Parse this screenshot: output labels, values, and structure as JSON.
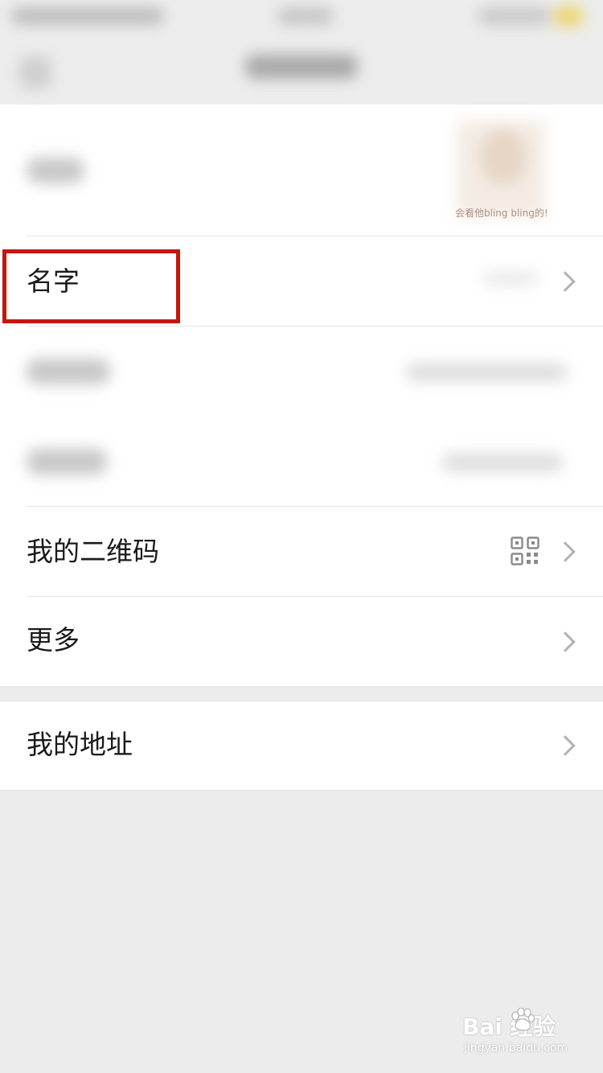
{
  "avatar": {
    "caption": "会看他bling bling的!"
  },
  "rows": {
    "name_label": "名字",
    "qrcode_label": "我的二维码",
    "more_label": "更多",
    "address_label": "我的地址"
  },
  "watermark": {
    "brand": "Bai 经验",
    "url": "jingyan.baidu.com"
  },
  "colors": {
    "highlight": "#c4170c",
    "background": "#ececec",
    "chevron": "#b2b2b2"
  },
  "icons": [
    "chevron-right-icon",
    "qr-code-icon",
    "baidu-paw-icon"
  ]
}
